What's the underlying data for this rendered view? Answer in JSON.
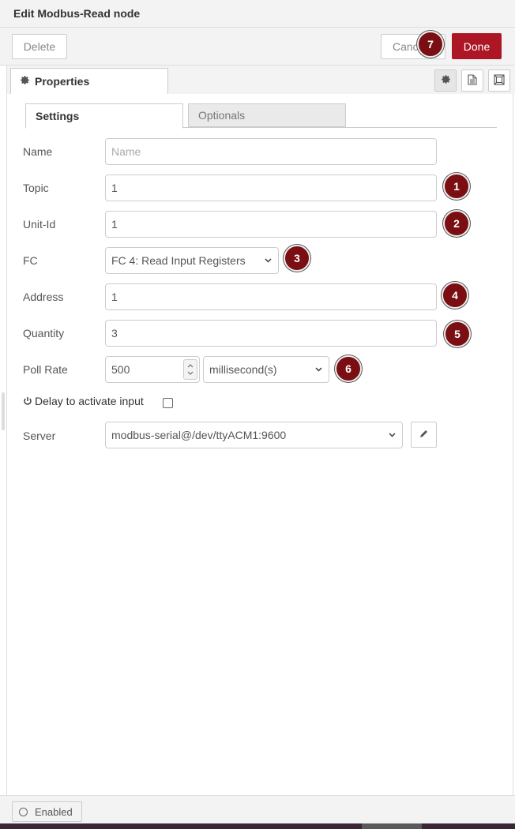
{
  "dialog": {
    "title": "Edit Modbus-Read node"
  },
  "toolbar": {
    "delete_label": "Delete",
    "cancel_label": "Cancel",
    "done_label": "Done"
  },
  "tabs": {
    "properties_label": "Properties"
  },
  "subtabs": {
    "settings_label": "Settings",
    "optionals_label": "Optionals"
  },
  "form": {
    "name": {
      "label": "Name",
      "value": "",
      "placeholder": "Name"
    },
    "topic": {
      "label": "Topic",
      "value": "1"
    },
    "unit_id": {
      "label": "Unit-Id",
      "value": "1"
    },
    "fc": {
      "label": "FC",
      "value": "FC 4: Read Input Registers"
    },
    "address": {
      "label": "Address",
      "value": "1"
    },
    "quantity": {
      "label": "Quantity",
      "value": "3"
    },
    "poll_rate": {
      "label": "Poll Rate",
      "value": "500",
      "unit": "millisecond(s)"
    },
    "delay": {
      "label": "Delay to activate input",
      "checked": false
    },
    "server": {
      "label": "Server",
      "value": "modbus-serial@/dev/ttyACM1:9600"
    }
  },
  "badges": [
    "1",
    "2",
    "3",
    "4",
    "5",
    "6",
    "7"
  ],
  "footer": {
    "enabled_label": "Enabled"
  },
  "colors": {
    "primary": "#ad1625",
    "badge": "#7a0e12"
  },
  "icons": {
    "properties": "gear-icon",
    "settings_tab": "gear-icon",
    "description_tab": "document-icon",
    "appearance_tab": "frame-icon",
    "server_edit": "pencil-icon",
    "delay": "power-icon",
    "enabled": "circle-icon"
  }
}
